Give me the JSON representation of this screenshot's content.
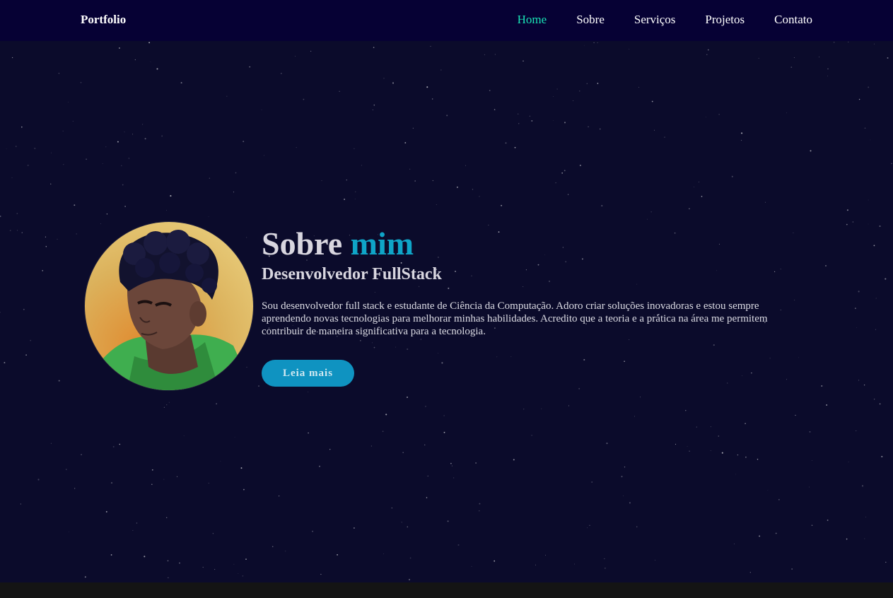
{
  "navbar": {
    "logo": "Portfolio",
    "links": [
      {
        "label": "Home",
        "active": true
      },
      {
        "label": "Sobre",
        "active": false
      },
      {
        "label": "Serviços",
        "active": false
      },
      {
        "label": "Projetos",
        "active": false
      },
      {
        "label": "Contato",
        "active": false
      }
    ]
  },
  "about": {
    "title_main": "Sobre ",
    "title_highlight": "mim",
    "subtitle": "Desenvolvedor FullStack",
    "description": "Sou desenvolvedor full stack e estudante de Ciência da Computação. Adoro criar soluções inovadoras e estou sempre aprendendo novas tecnologias para melhorar minhas habilidades. Acredito que a teoria e a prática na área me permitem contribuir de maneira significativa para a tecnologia.",
    "button_label": "Leia mais"
  },
  "colors": {
    "navbar_bg": "#060134",
    "page_bg": "#0b0b2b",
    "active_link": "#19e3b5",
    "accent": "#0fa5c8",
    "button_bg": "#0f93c1"
  }
}
